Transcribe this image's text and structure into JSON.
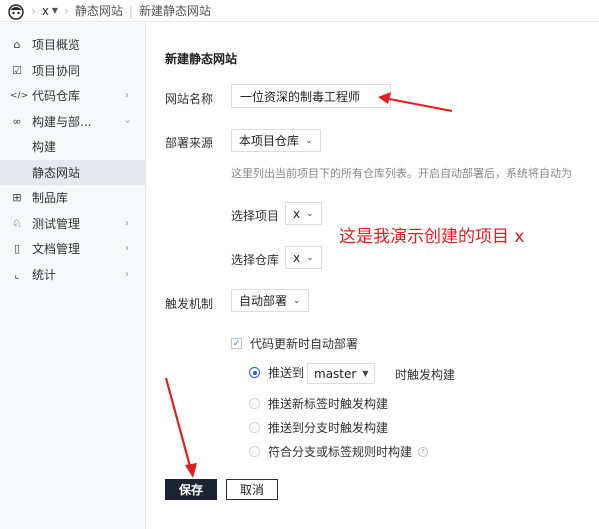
{
  "breadcrumb": {
    "project": "x",
    "section": "静态网站",
    "page": "新建静态网站"
  },
  "sidebar": {
    "items": [
      {
        "icon": "home-icon",
        "glyph": "⌂",
        "label": "项目概览",
        "chevron": false
      },
      {
        "icon": "checkbox-icon",
        "glyph": "☑",
        "label": "项目协同",
        "chevron": false
      },
      {
        "icon": "code-icon",
        "glyph": "</>",
        "label": "代码仓库",
        "chevron": true
      },
      {
        "icon": "infinity-icon",
        "glyph": "∞",
        "label": "构建与部...",
        "chevron": true,
        "expanded": true
      },
      {
        "icon": "",
        "glyph": "",
        "label": "构建",
        "sub": true
      },
      {
        "icon": "",
        "glyph": "",
        "label": "静态网站",
        "sub": true,
        "active": true
      },
      {
        "icon": "package-icon",
        "glyph": "⊞",
        "label": "制品库",
        "chevron": false
      },
      {
        "icon": "test-icon",
        "glyph": "♘",
        "label": "测试管理",
        "chevron": true
      },
      {
        "icon": "document-icon",
        "glyph": "▯",
        "label": "文档管理",
        "chevron": true
      },
      {
        "icon": "chart-icon",
        "glyph": "⌞",
        "label": "统计",
        "chevron": true
      }
    ]
  },
  "form": {
    "title": "新建静态网站",
    "site_name_label": "网站名称",
    "site_name_value": "一位资深的制毒工程师",
    "source_label": "部署来源",
    "source_value": "本项目仓库",
    "source_hint": "这里列出当前项目下的所有仓库列表。开启自动部署后，系统将自动为",
    "project_label": "选择项目",
    "project_value": "x",
    "repo_label": "选择仓库",
    "repo_value": "x",
    "trigger_label": "触发机制",
    "trigger_value": "自动部署",
    "auto_deploy_check": "代码更新时自动部署",
    "radio_push_to": "推送到",
    "branch_value": "master",
    "radio_push_to_suffix": "时触发构建",
    "radio_new_tag": "推送新标签时触发构建",
    "radio_branch": "推送到分支时触发构建",
    "radio_rule": "符合分支或标签规则时构建",
    "save_label": "保存",
    "cancel_label": "取消"
  },
  "annotation_text": "这是我演示创建的项目 x",
  "colors": {
    "annotation": "#e02020",
    "primary": "#1c2433",
    "radio_active": "#1e5fd8"
  }
}
